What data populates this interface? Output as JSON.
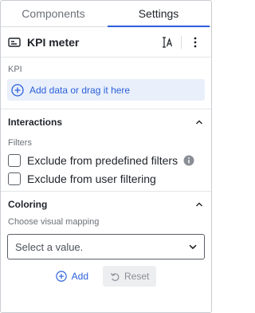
{
  "tabs": [
    {
      "label": "Components",
      "active": false
    },
    {
      "label": "Settings",
      "active": true
    }
  ],
  "header": {
    "title": "KPI meter",
    "icon": "kpi-card-icon",
    "rename_icon": "text-cursor-icon",
    "more_icon": "more-vertical-icon"
  },
  "kpi": {
    "label": "KPI",
    "add_data_text": "Add data or drag it here"
  },
  "interactions": {
    "heading": "Interactions",
    "filters_label": "Filters",
    "checkboxes": [
      {
        "label": "Exclude from predefined filters",
        "checked": false,
        "has_info": true
      },
      {
        "label": "Exclude from user filtering",
        "checked": false,
        "has_info": false
      }
    ]
  },
  "coloring": {
    "heading": "Coloring",
    "visual_mapping_label": "Choose visual mapping",
    "select_placeholder": "Select a value.",
    "add_label": "Add",
    "reset_label": "Reset"
  },
  "colors": {
    "accent": "#2b5fd9",
    "accent_bg": "#e9f0fb",
    "text": "#1f2329",
    "muted": "#6b7178"
  }
}
